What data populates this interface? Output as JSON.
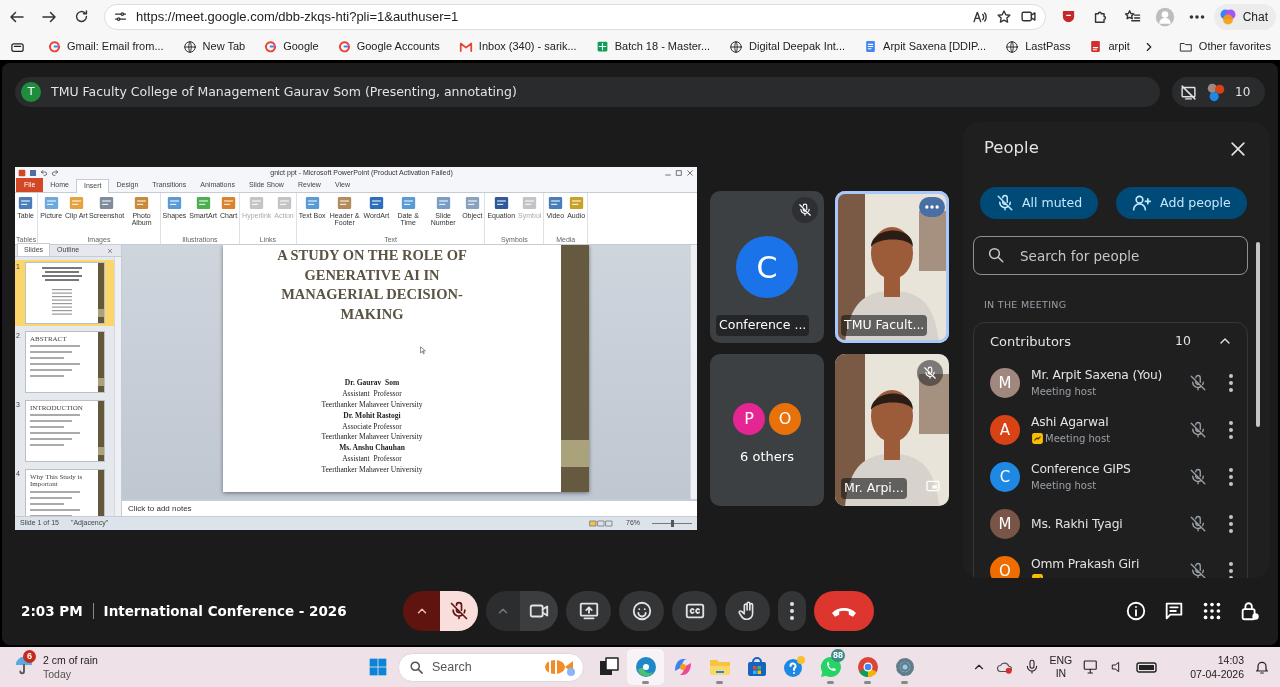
{
  "browser": {
    "url": "https://meet.google.com/dbb-zkqs-hti?pli=1&authuser=1",
    "chat_label": "Chat",
    "bookmarks": [
      {
        "kind": "g",
        "label": "Gmail: Email from..."
      },
      {
        "kind": "globe",
        "label": "New Tab"
      },
      {
        "kind": "g",
        "label": "Google"
      },
      {
        "kind": "g",
        "label": "Google Accounts"
      },
      {
        "kind": "mail",
        "label": "Inbox (340) - sarik..."
      },
      {
        "kind": "sheet",
        "label": "Batch 18 - Master..."
      },
      {
        "kind": "globe",
        "label": "Digital Deepak Int..."
      },
      {
        "kind": "doc",
        "label": "Arpit Saxena [DDIP..."
      },
      {
        "kind": "globe",
        "label": "LastPass"
      },
      {
        "kind": "pdf",
        "label": "arpit"
      }
    ],
    "other_favorites": "Other favorites"
  },
  "meeting": {
    "presenter_bar": {
      "initial": "T",
      "color": "#1e8e3e",
      "title": "TMU Faculty College of Management Gaurav Som (Presenting, annotating)"
    },
    "participant_count": "10",
    "presentation": {
      "window_title": "gnict ppt - Microsoft PowerPoint (Product Activation Failed)",
      "ribbon_tabs": [
        {
          "kind": "file",
          "label": "File",
          "selected": false
        },
        {
          "kind": "tab",
          "label": "Home",
          "selected": false
        },
        {
          "kind": "tab",
          "label": "Insert",
          "selected": true
        },
        {
          "kind": "tab",
          "label": "Design",
          "selected": false
        },
        {
          "kind": "tab",
          "label": "Transitions",
          "selected": false
        },
        {
          "kind": "tab",
          "label": "Animations",
          "selected": false
        },
        {
          "kind": "tab",
          "label": "Slide Show",
          "selected": false
        },
        {
          "kind": "tab",
          "label": "Review",
          "selected": false
        },
        {
          "kind": "tab",
          "label": "View",
          "selected": false
        }
      ],
      "ribbon_groups": [
        {
          "label": "Tables",
          "buttons": [
            {
              "label": "Table",
              "disabled": false
            }
          ]
        },
        {
          "label": "Images",
          "buttons": [
            {
              "label": "Picture",
              "disabled": false
            },
            {
              "label": "Clip Art",
              "disabled": false
            },
            {
              "label": "Screenshot",
              "disabled": false
            },
            {
              "label": "Photo Album",
              "disabled": false
            }
          ]
        },
        {
          "label": "Illustrations",
          "buttons": [
            {
              "label": "Shapes",
              "disabled": false
            },
            {
              "label": "SmartArt",
              "disabled": false
            },
            {
              "label": "Chart",
              "disabled": false
            }
          ]
        },
        {
          "label": "Links",
          "buttons": [
            {
              "label": "Hyperlink",
              "disabled": true
            },
            {
              "label": "Action",
              "disabled": true
            }
          ]
        },
        {
          "label": "Text",
          "buttons": [
            {
              "label": "Text Box",
              "disabled": false
            },
            {
              "label": "Header & Footer",
              "disabled": false
            },
            {
              "label": "WordArt",
              "disabled": false
            },
            {
              "label": "Date & Time",
              "disabled": false
            },
            {
              "label": "Slide Number",
              "disabled": false
            },
            {
              "label": "Object",
              "disabled": false
            }
          ]
        },
        {
          "label": "Symbols",
          "buttons": [
            {
              "label": "Equation",
              "disabled": false
            },
            {
              "label": "Symbol",
              "disabled": true
            }
          ]
        },
        {
          "label": "Media",
          "buttons": [
            {
              "label": "Video",
              "disabled": false
            },
            {
              "label": "Audio",
              "disabled": false
            }
          ]
        }
      ],
      "pane_tabs": [
        {
          "label": "Slides",
          "selected": true
        },
        {
          "label": "Outline",
          "selected": false
        }
      ],
      "thumbnails": [
        {
          "number": "1",
          "selected": true
        },
        {
          "number": "2",
          "title": "ABSTRACT",
          "selected": false
        },
        {
          "number": "3",
          "title": "INTRODUCTION",
          "selected": false
        },
        {
          "number": "4",
          "title": "Why This Study is Important",
          "selected": false
        }
      ],
      "slide": {
        "title_lines": [
          "A STUDY ON THE ROLE OF",
          "GENERATIVE AI IN",
          "MANAGERIAL DECISION-",
          "MAKING"
        ],
        "authors": [
          {
            "text": "Dr. Gaurav  Som",
            "bold": true
          },
          {
            "text": "Assistant  Professor",
            "bold": false
          },
          {
            "text": "Teerthanker Mahaveer University",
            "bold": false
          },
          {
            "text": "Dr. Mohit Rastogi",
            "bold": true
          },
          {
            "text": "Associate Professor",
            "bold": false
          },
          {
            "text": "Teerthanker Mahaveer University",
            "bold": false
          },
          {
            "text": "Ms. Anshu Chauhan",
            "bold": true
          },
          {
            "text": "Assistant  Professor",
            "bold": false
          },
          {
            "text": "Teerthanker Mahaveer University",
            "bold": false
          }
        ]
      },
      "notes_placeholder": "Click to add notes",
      "status": {
        "slide_info": "Slide 1 of 15",
        "theme": "\"Adjacency\"",
        "zoom": "76%",
        "zoom_slider": {
          "level": 0.5
        }
      }
    },
    "tiles": [
      {
        "kind": "avatar",
        "initial": "C",
        "color": "#1a73e8",
        "name": "Conference ...",
        "muted": true,
        "speaking": false
      },
      {
        "kind": "video",
        "name": "TMU Facult...",
        "muted": false,
        "speaking": true,
        "self_view": false
      },
      {
        "kind": "others",
        "avatars": [
          {
            "initial": "P",
            "color": "#e52592"
          },
          {
            "initial": "O",
            "color": "#e8710a"
          }
        ],
        "label": "6 others"
      },
      {
        "kind": "video",
        "name": "Mr. Arpi...",
        "muted": true,
        "speaking": false,
        "self_view": true
      }
    ],
    "people_panel": {
      "title": "People",
      "all_muted": "All muted",
      "add_people": "Add people",
      "search_placeholder": "Search for people",
      "section": "IN THE MEETING",
      "group": {
        "label": "Contributors",
        "count": "10",
        "expanded": true
      },
      "people": [
        {
          "initial": "M",
          "name": "Mr. Arpit Saxena (You)",
          "role": "Meeting host",
          "color": "#a1887f",
          "presenting": false,
          "muted": true
        },
        {
          "initial": "A",
          "name": "Ashi Agarwal",
          "role": "Meeting host",
          "color": "#d84315",
          "presenting": true,
          "muted": true
        },
        {
          "initial": "C",
          "name": "Conference GIPS",
          "role": "Meeting host",
          "color": "#1e88e5",
          "presenting": false,
          "muted": true
        },
        {
          "initial": "M",
          "name": "Ms. Rakhi Tyagi",
          "color": "#795548",
          "presenting": false,
          "muted": true
        },
        {
          "initial": "O",
          "name": "Omm Prakash Giri",
          "color": "#ef6c00",
          "presenting": true,
          "muted": true
        }
      ]
    },
    "controls": {
      "time": "2:03 PM",
      "meeting_name": "International Conference - 2026",
      "buttons": [
        {
          "kind": "mic",
          "muted": true
        },
        {
          "kind": "camera",
          "off": false
        },
        {
          "kind": "present"
        },
        {
          "kind": "emoji"
        },
        {
          "kind": "captions"
        },
        {
          "kind": "hand"
        },
        {
          "kind": "more"
        },
        {
          "kind": "end"
        }
      ]
    }
  },
  "taskbar": {
    "weather": {
      "badge": "6",
      "text": "2 cm of rain",
      "subtext": "Today"
    },
    "search_label": "Search",
    "apps": [
      {
        "kind": "taskview",
        "selected": false,
        "running": false
      },
      {
        "kind": "edge",
        "selected": true,
        "running": true
      },
      {
        "kind": "copilot",
        "selected": false,
        "running": false
      },
      {
        "kind": "files",
        "selected": false,
        "running": true
      },
      {
        "kind": "store",
        "selected": false,
        "running": false
      },
      {
        "kind": "help",
        "selected": false,
        "running": false
      },
      {
        "kind": "whatsapp",
        "badge": "88",
        "selected": false,
        "running": true
      },
      {
        "kind": "chrome",
        "selected": false,
        "running": true
      },
      {
        "kind": "settings",
        "selected": false,
        "running": true
      }
    ],
    "language": "ENG",
    "region": "IN",
    "time": "14:03",
    "date": "07-04-2026"
  }
}
